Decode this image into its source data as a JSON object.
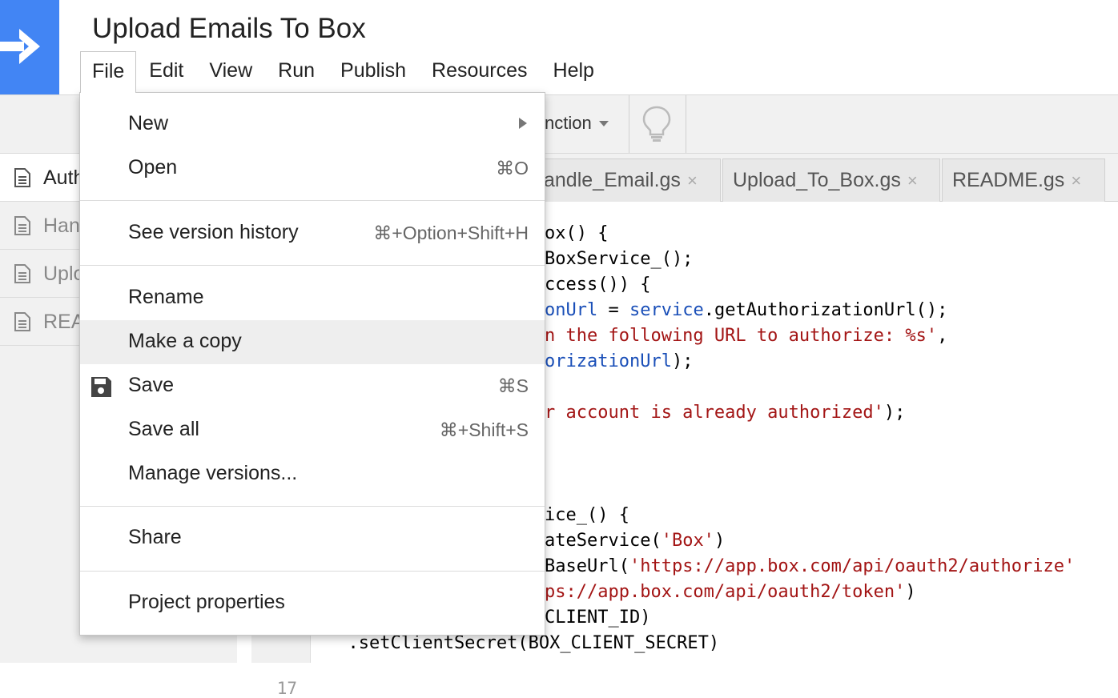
{
  "app": {
    "title": "Upload Emails To Box"
  },
  "menubar": [
    "File",
    "Edit",
    "View",
    "Run",
    "Publish",
    "Resources",
    "Help"
  ],
  "toolbar": {
    "function_select": "nction"
  },
  "sidebar": {
    "items": [
      {
        "label": "Auth"
      },
      {
        "label": "Han"
      },
      {
        "label": "Uplo"
      },
      {
        "label": "REA"
      }
    ]
  },
  "tabs": [
    {
      "label": "andle_Email.gs",
      "close": "×"
    },
    {
      "label": "Upload_To_Box.gs",
      "close": "×"
    },
    {
      "label": "README.gs",
      "close": "×"
    }
  ],
  "gutter": {
    "visible_line": "17"
  },
  "code": {
    "l1": "ox() {",
    "l2": "BoxService_();",
    "l3": "ccess()) {",
    "l4a": "onUrl",
    "l4b": " = ",
    "l4c": "service",
    "l4d": ".getAuthorizationUrl();",
    "l5a": "n the following URL to authorize: %s'",
    "l5b": ",",
    "l6a": "orizationUrl",
    "l6b": ");",
    "l7a": "r account is already authorized'",
    "l7b": ");",
    "l8": "ice_() {",
    "l9a": "ateService(",
    "l9b": "'Box'",
    "l9c": ")",
    "l10a": "BaseUrl(",
    "l10b": "'https://app.box.com/api/oauth2/authorize'",
    "l11a": "ps://app.box.com/api/oauth2/token'",
    "l11b": ")",
    "l12": "CLIENT_ID)",
    "l13": "  .setClientSecret(BOX_CLIENT_SECRET)"
  },
  "file_menu": {
    "items": [
      {
        "label": "New",
        "shortcut": "",
        "submenu": true
      },
      {
        "label": "Open",
        "shortcut": "⌘O"
      },
      {
        "label": "See version history",
        "shortcut": "⌘+Option+Shift+H"
      },
      {
        "label": "Rename",
        "shortcut": ""
      },
      {
        "label": "Make a copy",
        "shortcut": "",
        "highlighted": true
      },
      {
        "label": "Save",
        "shortcut": "⌘S",
        "icon": "save-icon"
      },
      {
        "label": "Save all",
        "shortcut": "⌘+Shift+S"
      },
      {
        "label": "Manage versions...",
        "shortcut": ""
      },
      {
        "label": "Share",
        "shortcut": ""
      },
      {
        "label": "Project properties",
        "shortcut": ""
      }
    ]
  },
  "colors": {
    "brand_blue": "#4285f4",
    "code_blue": "#1a4fb8",
    "code_red": "#a31515",
    "menu_highlight": "#eeeeee"
  }
}
